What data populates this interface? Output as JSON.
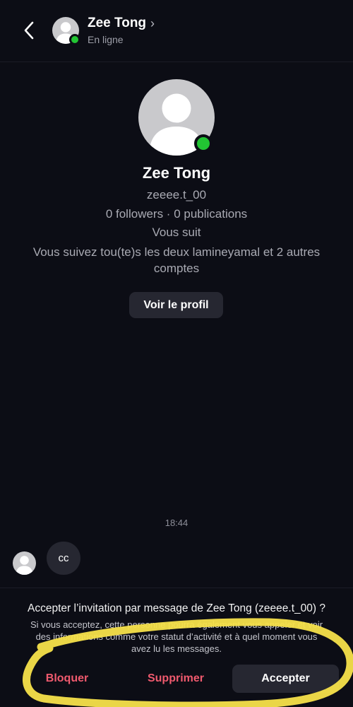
{
  "header": {
    "back_icon": "chevron-left-icon",
    "name": "Zee Tong",
    "chevron": "›",
    "status": "En ligne"
  },
  "profile": {
    "name": "Zee Tong",
    "username": "zeeee.t_00",
    "stats": "0 followers · 0 publications",
    "follows_you": "Vous suit",
    "mutual": "Vous suivez tou(te)s les deux lamineyamal et 2 autres comptes",
    "view_profile_label": "Voir le profil"
  },
  "conversation": {
    "timestamp": "18:44",
    "messages": [
      {
        "text": "cc"
      }
    ]
  },
  "invite": {
    "title": "Accepter l’invitation par message de Zee Tong (zeeee.t_00) ?",
    "description": "Si vous acceptez, cette personne pourra également vous appeler et voir des informations comme votre statut d’activité et à quel moment vous avez lu les messages.",
    "block_label": "Bloquer",
    "delete_label": "Supprimer",
    "accept_label": "Accepter"
  },
  "colors": {
    "background": "#0c0d15",
    "online": "#22c533",
    "danger": "#f05a6e",
    "button_bg": "#262731",
    "highlight": "#f7e24a"
  }
}
